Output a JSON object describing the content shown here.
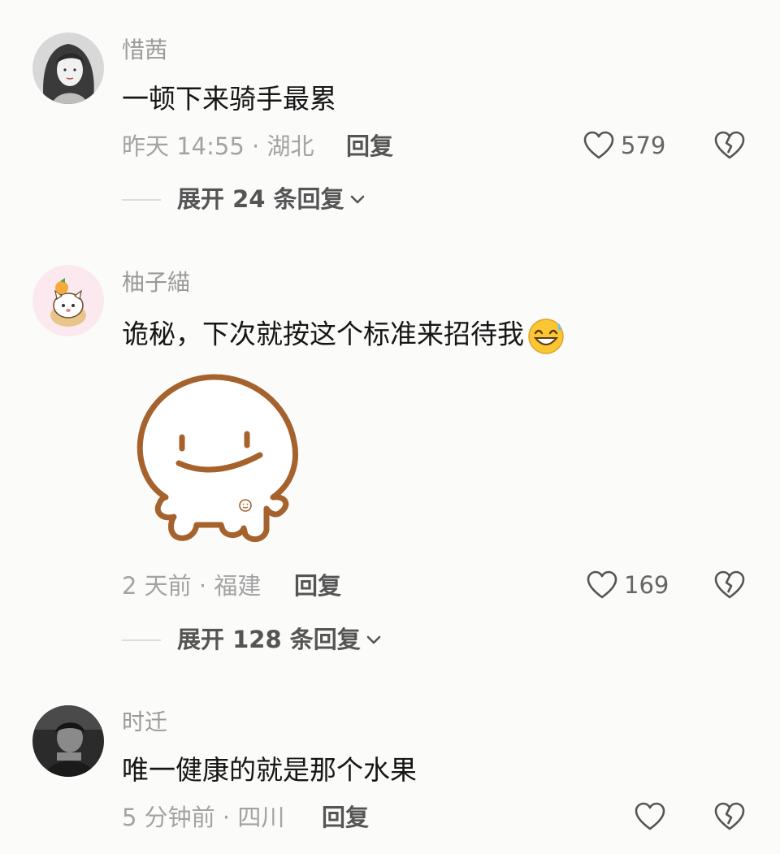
{
  "comments": [
    {
      "username": "惜茜",
      "text": "一顿下来骑手最累",
      "meta": "昨天 14:55 · 湖北",
      "reply_label": "回复",
      "like_count": "579",
      "expand_label": "展开 24 条回复",
      "avatar_icon": "girl-portrait-avatar"
    },
    {
      "username": "柚子緢",
      "text": "诡秘，下次就按这个标准来招待我",
      "emoji": "grinning-sweat-emoji",
      "sticker": "smiling-doodle-sticker",
      "meta": "2 天前 · 福建",
      "reply_label": "回复",
      "like_count": "169",
      "expand_label": "展开 128 条回复",
      "avatar_icon": "cat-with-orange-avatar"
    },
    {
      "username": "时迁",
      "text": "唯一健康的就是那个水果",
      "meta": "5 分钟前 · 四川",
      "reply_label": "回复",
      "like_count": "",
      "avatar_icon": "dark-photo-avatar"
    }
  ],
  "icons": {
    "like": "heart-outline-icon",
    "dislike": "broken-heart-icon",
    "expand": "chevron-down-icon"
  },
  "colors": {
    "background": "#fbfbfa",
    "username": "#9a9a9a",
    "text": "#161616",
    "meta": "#a3a3a3",
    "sticker_stroke": "#a6622c"
  }
}
